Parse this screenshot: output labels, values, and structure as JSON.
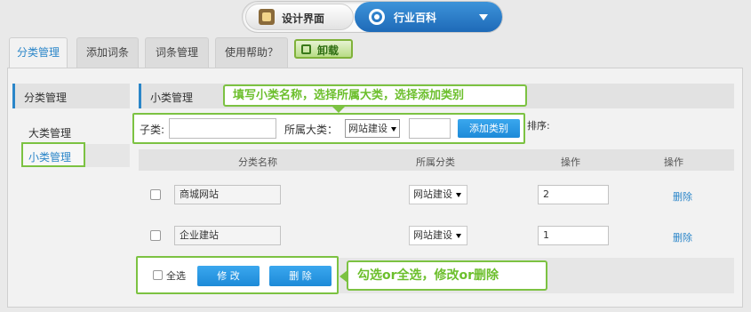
{
  "header": {
    "mode_left": "设计界面",
    "mode_right": "行业百科",
    "colors": {
      "accent_blue": "#1e6ab8",
      "highlight_green": "#7cc242"
    }
  },
  "tabs": [
    "分类管理",
    "添加词条",
    "词条管理",
    "使用帮助？"
  ],
  "unload_label": "卸载",
  "sidebar": {
    "title": "分类管理",
    "items": [
      "大类管理",
      "小类管理"
    ]
  },
  "main": {
    "title": "小类管理",
    "callout_top": "填写小类名称，选择所属大类，选择添加类别",
    "form": {
      "sub_label": "子类:",
      "parent_label": "所属大类：",
      "parent_value": "网站建设",
      "add_button": "添加类别",
      "sort_label": "排序:"
    },
    "columns": [
      "分类名称",
      "所属分类",
      "操作",
      "操作"
    ],
    "rows": [
      {
        "name": "商城网站",
        "category": "网站建设",
        "sort": "2",
        "action": "删除"
      },
      {
        "name": "企业建站",
        "category": "网站建设",
        "sort": "1",
        "action": "删除"
      }
    ],
    "bottom": {
      "select_all": "全选",
      "edit_button": "修 改",
      "delete_button": "删 除",
      "callout": "勾选or全选，修改or删除"
    }
  }
}
